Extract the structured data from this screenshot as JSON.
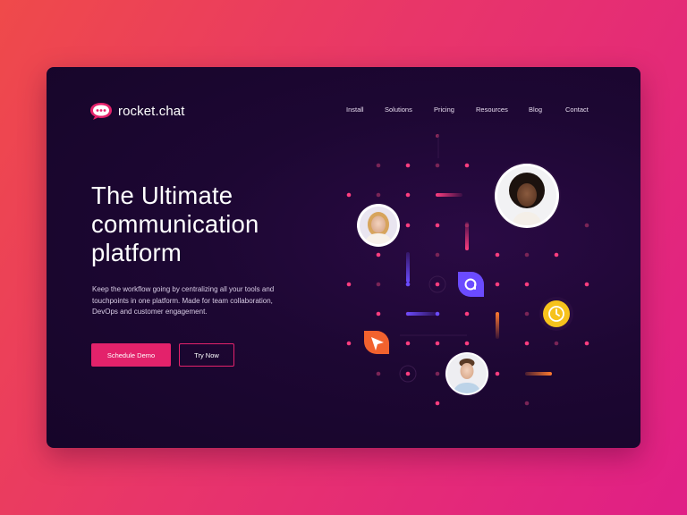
{
  "brand": {
    "name": "rocket.chat",
    "accent": "#e3226b"
  },
  "nav": {
    "items": [
      "Install",
      "Solutions",
      "Pricing",
      "Resources",
      "Blog",
      "Contact"
    ]
  },
  "hero": {
    "title": "The Ultimate communication platform",
    "description": "Keep the workflow going by centralizing all your tools and touchpoints in one platform. Made for team collaboration, DevOps and customer engagement.",
    "primary_cta": "Schedule Demo",
    "secondary_cta": "Try Now"
  },
  "illustration": {
    "avatars": [
      "woman-avatar",
      "woman-avatar",
      "man-avatar"
    ],
    "icons": [
      "chat-bubble-icon",
      "clock-icon",
      "cursor-arrow-icon"
    ]
  }
}
